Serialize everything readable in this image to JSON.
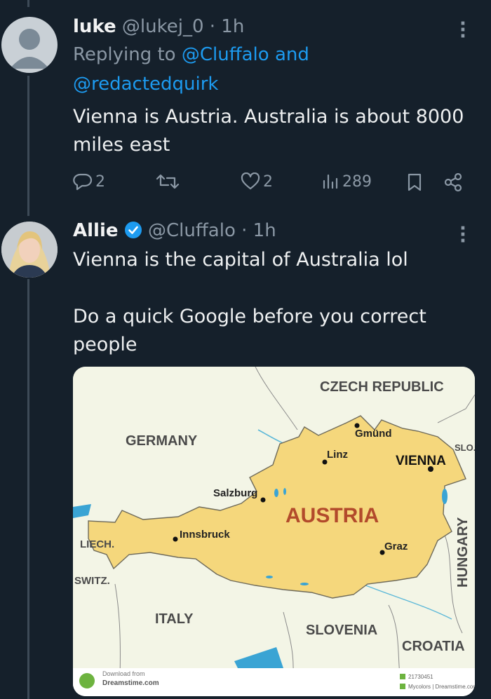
{
  "tweet1": {
    "name": "luke",
    "handle": "@lukej_0 · 1h",
    "replying_prefix": "Replying to",
    "replying_to_1": "@Cluffalo and",
    "replying_to_2": "@redactedquirk",
    "text_line1": "Vienna is Austria. Australia is about 8000",
    "text_line2": "miles east",
    "stats": {
      "replies": "2",
      "likes": "2",
      "views": "289"
    }
  },
  "tweet2": {
    "name": "Allie",
    "handle": "@Cluffalo · 1h",
    "line1": "Vienna is the capital of Australia lol",
    "line2": "Do a quick Google before you correct",
    "line3": "people"
  },
  "map": {
    "countries": {
      "czech": "CZECH REPUBLIC",
      "germany": "GERMANY",
      "austria": "AUSTRIA",
      "liech": "LIECH.",
      "switz": "SWITZ.",
      "italy": "ITALY",
      "slovenia": "SLOVENIA",
      "croatia": "CROATIA",
      "hungary": "HUNGARY",
      "slo": "SLO."
    },
    "cities": {
      "gmund": "Gmünd",
      "linz": "Linz",
      "vienna": "VIENNA",
      "salzburg": "Salzburg",
      "innsbruck": "Innsbruck",
      "graz": "Graz"
    },
    "watermark_line1": "Download from",
    "watermark_line2": "Dreamstime.com",
    "id_text": "21730451",
    "credit_text": "Mycolors | Dreamstime.com"
  },
  "colors": {
    "background": "#15202b",
    "link": "#1d9bf0",
    "muted": "#8b98a5",
    "austria_fill": "#f5d77c",
    "verified": "#1d9bf0"
  }
}
